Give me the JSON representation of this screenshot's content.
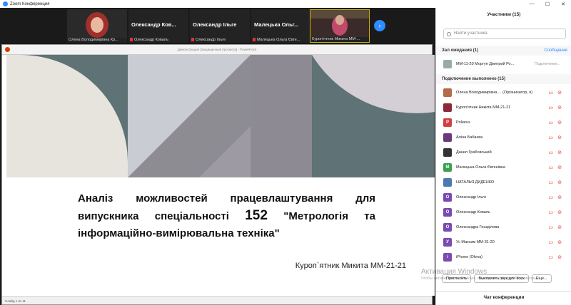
{
  "window": {
    "title": "Zoom Конференция",
    "controls": [
      "—",
      "☐",
      "✕"
    ]
  },
  "video_strip": {
    "tiles": [
      {
        "name": "Олена Володимирівна Кр...",
        "big": "",
        "muted": false,
        "photo": true
      },
      {
        "name": "Олександр Коваль",
        "big": "Олександр  Ков...",
        "muted": true,
        "photo": false
      },
      {
        "name": "Олександр Ільге",
        "big": "Олександр Ільге",
        "muted": true,
        "photo": false
      },
      {
        "name": "Малецька Ольга Євге...",
        "big": "Малецька  Ольг...",
        "muted": true,
        "photo": false
      },
      {
        "name": "Куроп'ятник Микита ММ-...",
        "big": "",
        "muted": false,
        "photo": true
      }
    ],
    "next_icon": "chevron-right-icon"
  },
  "presentation": {
    "titlebar": "Демонстрация [Защищенный просмотр] - PowerPoint",
    "title_pre": "Аналіз можливостей працевлаштування для випускника спеціальності ",
    "title_num": "152",
    "title_post": " \"Метрологія та інформаційно-вимірювальна техніка\"",
    "author": "Куроп`ятник Микита ММ-21-21",
    "status": "Слайд 1 из 11"
  },
  "participants": {
    "header": "Участники (15)",
    "search_placeholder": "Найти участника",
    "waiting_label": "Зал ожидания (1)",
    "waiting_link": "Сообщение",
    "waiting_person": "ММ-11-20 Моргун Дмитрий Ро...",
    "waiting_action": "Подключение...",
    "connected_label": "Подключение выполнено (15)",
    "people": [
      {
        "name": "Олена Володимирівна ... (Организатор, я)",
        "initial": "",
        "color": "#b56a4a"
      },
      {
        "name": "Куроп'ятник Никита ММ-21-21",
        "initial": "",
        "color": "#8a2a3a"
      },
      {
        "name": "Poliarus",
        "initial": "P",
        "color": "#d04040"
      },
      {
        "name": "Аліна Бабаєва",
        "initial": "",
        "color": "#6a3a7a"
      },
      {
        "name": "Данил Грабовський",
        "initial": "",
        "color": "#333333"
      },
      {
        "name": "Малецька Ольга Євгенівна",
        "initial": "М",
        "color": "#3aa050"
      },
      {
        "name": "НАТАЛЬЯ ДИДЕНКО",
        "initial": "",
        "color": "#4a7ab0"
      },
      {
        "name": "Олександр Ільге",
        "initial": "О",
        "color": "#7a4ab0"
      },
      {
        "name": "Олександр Коваль",
        "initial": "О",
        "color": "#7a4ab0"
      },
      {
        "name": "Олександра Гнєзділова",
        "initial": "О",
        "color": "#7a4ab0"
      },
      {
        "name": "Ус Максим ММ-31-20",
        "initial": "У",
        "color": "#7a4ab0"
      },
      {
        "name": "iPhone (Olena)",
        "initial": "i",
        "color": "#7a4ab0"
      }
    ],
    "invite": "Пригласить",
    "mute_all": "Выключить звук для всех",
    "more": "Еще..."
  },
  "watermark": {
    "line1": "Активация Windows",
    "line2": "Чтобы активировать Windows, перейдите в раздел \"Параметры\"."
  },
  "chat": {
    "label": "Чат конференции"
  }
}
